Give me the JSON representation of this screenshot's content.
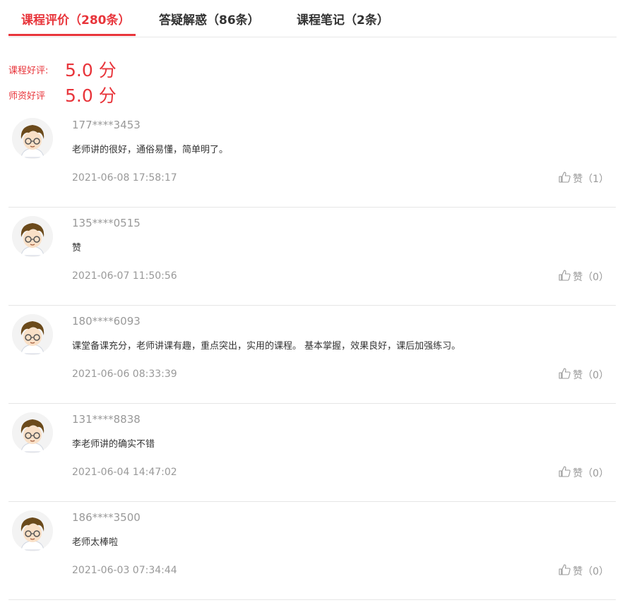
{
  "tabs": [
    {
      "label": "课程评价（280条）"
    },
    {
      "label": "答疑解惑（86条）"
    },
    {
      "label": "课程笔记（2条）"
    }
  ],
  "ratings": [
    {
      "label": "课程好评:",
      "score": "5.0 分"
    },
    {
      "label": "师资好评",
      "score": "5.0 分"
    }
  ],
  "reviews": [
    {
      "user": "177****3453",
      "content": "老师讲的很好，通俗易懂，简单明了。",
      "time": "2021-06-08 17:58:17",
      "like_label": "赞",
      "like_count": "（1）"
    },
    {
      "user": "135****0515",
      "content": "赞",
      "time": "2021-06-07 11:50:56",
      "like_label": "赞",
      "like_count": "（0）"
    },
    {
      "user": "180****6093",
      "content": "课堂备课充分，老师讲课有趣，重点突出，实用的课程。 基本掌握，效果良好，课后加强练习。",
      "time": "2021-06-06 08:33:39",
      "like_label": "赞",
      "like_count": "（0）"
    },
    {
      "user": "131****8838",
      "content": "李老师讲的确实不错",
      "time": "2021-06-04 14:47:02",
      "like_label": "赞",
      "like_count": "（0）"
    },
    {
      "user": "186****3500",
      "content": "老师太棒啦",
      "time": "2021-06-03 07:34:44",
      "like_label": "赞",
      "like_count": "（0）"
    }
  ]
}
